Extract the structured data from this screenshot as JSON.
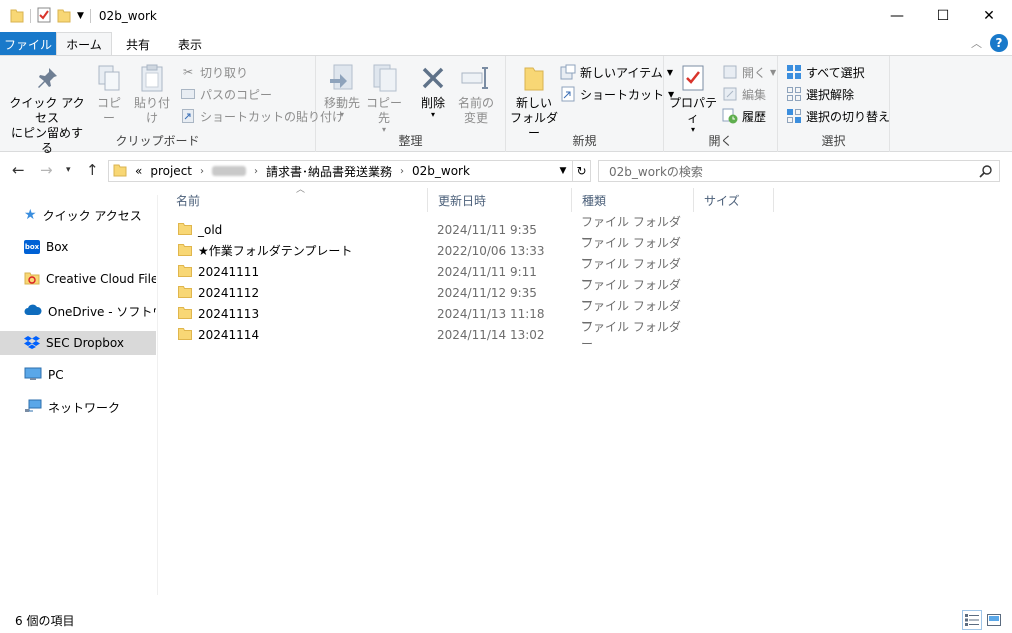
{
  "window": {
    "title": "02b_work",
    "minimize": "—",
    "maximize": "☐",
    "close": "✕"
  },
  "tabs": [
    {
      "label": "ファイル"
    },
    {
      "label": "ホーム"
    },
    {
      "label": "共有"
    },
    {
      "label": "表示"
    }
  ],
  "ribbon": {
    "clipboard": {
      "label": "クリップボード",
      "pin_line1": "クイック アクセス",
      "pin_line2": "にピン留めする",
      "copy": "コピー",
      "paste": "貼り付け",
      "cut": "切り取り",
      "copy_path": "パスのコピー",
      "paste_shortcut": "ショートカットの貼り付け"
    },
    "organize": {
      "label": "整理",
      "move_to": "移動先",
      "copy_to": "コピー先",
      "delete": "削除",
      "rename_line1": "名前の",
      "rename_line2": "変更"
    },
    "new": {
      "label": "新規",
      "new_folder_line1": "新しい",
      "new_folder_line2": "フォルダー",
      "new_item": "新しいアイテム",
      "shortcut": "ショートカット"
    },
    "open": {
      "label": "開く",
      "properties": "プロパティ",
      "open": "開く",
      "edit": "編集",
      "history": "履歴"
    },
    "select": {
      "label": "選択",
      "select_all": "すべて選択",
      "select_none": "選択解除",
      "invert": "選択の切り替え"
    }
  },
  "address": {
    "prefix": "«",
    "crumbs": [
      "project",
      "請求書･納品書発送業務",
      "02b_work"
    ],
    "search_placeholder": "02b_workの検索"
  },
  "sidebar": {
    "items": [
      {
        "label": "クイック アクセス"
      },
      {
        "label": "Box"
      },
      {
        "label": "Creative Cloud Files"
      },
      {
        "label": "OneDrive - ソフトウエア"
      },
      {
        "label": "SEC Dropbox"
      },
      {
        "label": "PC"
      },
      {
        "label": "ネットワーク"
      }
    ]
  },
  "columns": {
    "name": "名前",
    "modified": "更新日時",
    "type": "種類",
    "size": "サイズ"
  },
  "files": [
    {
      "name": "_old",
      "modified": "2024/11/11 9:35",
      "type": "ファイル フォルダー"
    },
    {
      "name": "★作業フォルダテンプレート",
      "modified": "2022/10/06 13:33",
      "type": "ファイル フォルダー"
    },
    {
      "name": "20241111",
      "modified": "2024/11/11 9:11",
      "type": "ファイル フォルダー"
    },
    {
      "name": "20241112",
      "modified": "2024/11/12 9:35",
      "type": "ファイル フォルダー"
    },
    {
      "name": "20241113",
      "modified": "2024/11/13 11:18",
      "type": "ファイル フォルダー"
    },
    {
      "name": "20241114",
      "modified": "2024/11/14 13:02",
      "type": "ファイル フォルダー"
    }
  ],
  "status": {
    "count": "6 個の項目"
  },
  "colors": {
    "accent": "#1979ca",
    "folder": "#f8d775",
    "selection": "#d9d9d9"
  }
}
